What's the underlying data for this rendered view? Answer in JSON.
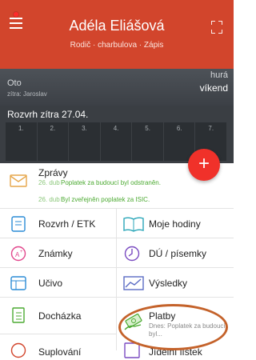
{
  "header": {
    "name": "Adéla Eliášová",
    "subtitle": "Rodič · charbulova · Zápis",
    "colors": {
      "primary": "#d2452c",
      "dark": "#3a3e43",
      "fab": "#f0312a",
      "green": "#4caa32"
    }
  },
  "info": {
    "lesson_title": "Oto",
    "lesson_sub": "zítra: Jaroslav",
    "status_top": "hurá",
    "status_main": "víkend",
    "schedule_title": "Rozvrh zítra 27.04.",
    "slots": [
      "1.",
      "2.",
      "3.",
      "4.",
      "5.",
      "6.",
      "7."
    ]
  },
  "fab": {
    "label": "+"
  },
  "messages": {
    "title": "Zprávy",
    "items": [
      {
        "date": "26. dub",
        "text": "Poplatek za budoucí byl odstraněn."
      },
      {
        "date": "26. dub",
        "text": "Byl zveřejněn poplatek za ISIC."
      }
    ]
  },
  "grid": {
    "rozvrh": "Rozvrh / ETK",
    "moje_hodiny": "Moje hodiny",
    "znamky": "Známky",
    "du": "DÚ / písemky",
    "ucivo": "Učivo",
    "vysledky": "Výsledky",
    "dochazka": "Docházka",
    "platby_title": "Platby",
    "platby_sub": "Dnes: Poplatek za budoucí byl...",
    "suplovani": "Suplování",
    "jidelni": "Jídelní lístek"
  },
  "icons": [
    "menu-icon",
    "qr-icon",
    "envelope-icon",
    "calendar-icon",
    "book-icon",
    "grade-icon",
    "clock-icon",
    "list-icon",
    "chart-icon",
    "checklist-icon",
    "money-icon",
    "person-icon"
  ]
}
